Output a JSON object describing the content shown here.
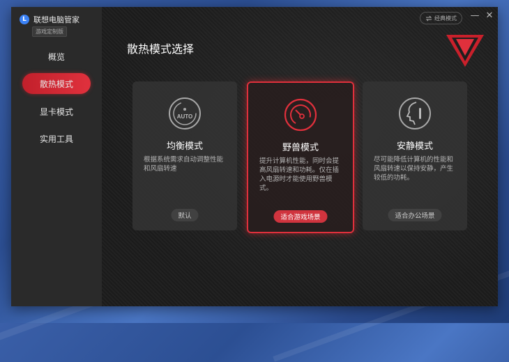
{
  "app": {
    "name": "联想电脑管家",
    "edition": "游戏定制版",
    "classic_mode": "经典模式",
    "minimize": "—",
    "close": "✕"
  },
  "sidebar": {
    "items": [
      {
        "label": "概览"
      },
      {
        "label": "散热模式"
      },
      {
        "label": "显卡模式"
      },
      {
        "label": "实用工具"
      }
    ],
    "active_index": 1
  },
  "main": {
    "title": "散热模式选择",
    "icon_auto_text": "AUTO",
    "cards": [
      {
        "title": "均衡模式",
        "desc": "根据系统需求自动调整性能和风扇转速",
        "button": "默认",
        "icon": "auto-gauge-icon"
      },
      {
        "title": "野兽模式",
        "desc": "提升计算机性能，同时会提高风扇转速和功耗。仅在插入电源时才能使用野兽模式。",
        "button": "适合游戏场景",
        "icon": "speedometer-icon",
        "selected": true
      },
      {
        "title": "安静模式",
        "desc": "尽可能降低计算机的性能和风扇转速以保持安静，产生较低的功耗。",
        "button": "适合办公场景",
        "icon": "quiet-face-icon"
      }
    ]
  },
  "colors": {
    "accent": "#e0303c",
    "sidebar_bg": "#2a2a2a",
    "main_bg": "#1e1e1e"
  }
}
